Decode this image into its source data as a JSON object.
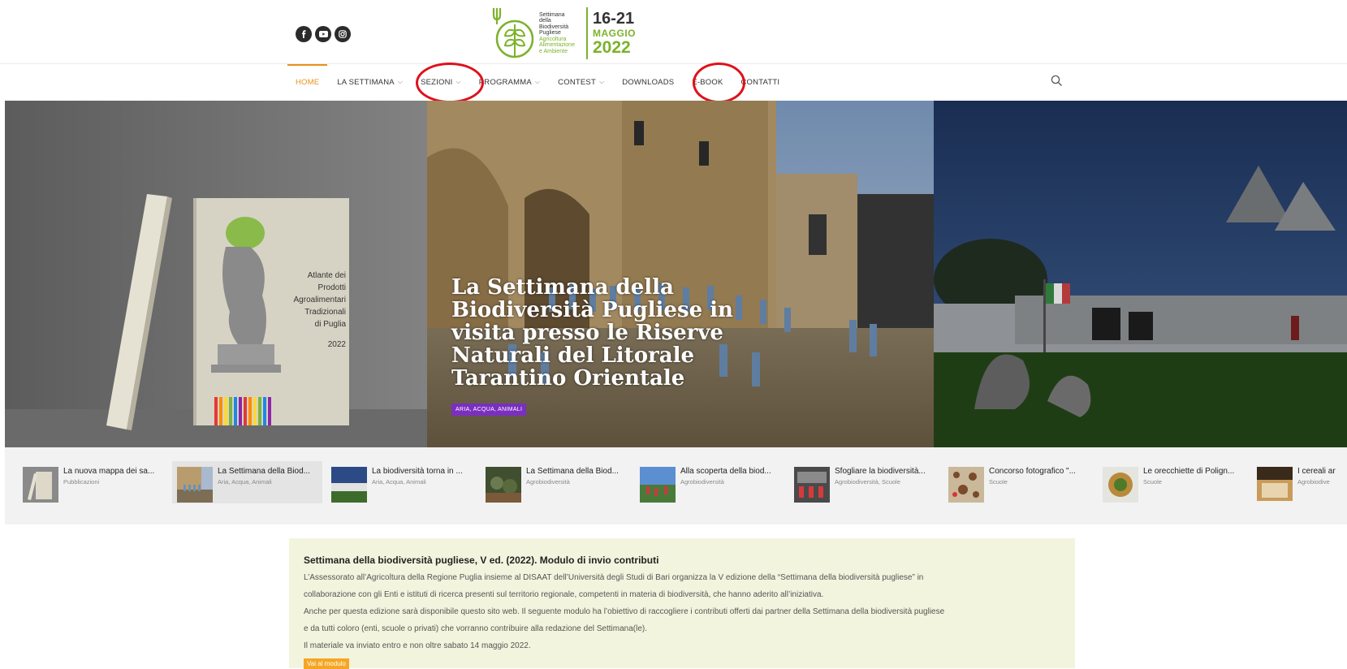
{
  "social": {
    "icons": [
      "facebook-icon",
      "youtube-icon",
      "instagram-icon"
    ]
  },
  "logo": {
    "lines": [
      "Settimana",
      "della",
      "Biodiversità",
      "Pugliese"
    ],
    "sub_lines": [
      "Agricoltura",
      "Alimentazione",
      "e Ambiente"
    ],
    "dates": "16-21",
    "month": "MAGGIO",
    "year": "2022"
  },
  "nav": {
    "items": [
      {
        "label": "HOME",
        "active": true,
        "dropdown": false
      },
      {
        "label": "LA SETTIMANA",
        "dropdown": true
      },
      {
        "label": "SEZIONI",
        "dropdown": true,
        "highlighted": true
      },
      {
        "label": "PROGRAMMA",
        "dropdown": true
      },
      {
        "label": "CONTEST",
        "dropdown": true
      },
      {
        "label": "DOWNLOADS",
        "dropdown": false
      },
      {
        "label": "E-BOOK",
        "dropdown": false,
        "highlighted": true
      },
      {
        "label": "CONTATTI",
        "dropdown": false
      }
    ],
    "accent": "#e8911a",
    "highlight_color": "#e0101a"
  },
  "book": {
    "title_lines": [
      "Atlante dei",
      "Prodotti",
      "Agroalimentari",
      "Tradizionali",
      "di Puglia"
    ],
    "year": "2022"
  },
  "slider": {
    "title": "La Settimana della Biodiversità Pugliese in visita presso le Riserve Naturali del Litorale Tarantino Orientale",
    "tag": "ARIA, ACQUA, ANIMALI",
    "tag_color": "#7a2fbf"
  },
  "thumbs": [
    {
      "title": "La nuova mappa dei sa...",
      "category": "Pubblicazioni"
    },
    {
      "title": "La Settimana della Biod...",
      "category": "Aria, Acqua, Animali",
      "selected": true
    },
    {
      "title": "La biodiversità torna in ...",
      "category": "Aria, Acqua, Animali"
    },
    {
      "title": "La Settimana della Biod...",
      "category": "Agrobiodiversità"
    },
    {
      "title": "Alla scoperta della biod...",
      "category": "Agrobiodiversità"
    },
    {
      "title": "Sfogliare la biodiversità...",
      "category": "Agrobiodiversità, Scuole"
    },
    {
      "title": "Concorso fotografico \"...",
      "category": "Scuole"
    },
    {
      "title": "Le orecchiette di Polign...",
      "category": "Scuole"
    },
    {
      "title": "I cereali ar",
      "category": "Agrobiodive"
    }
  ],
  "notice": {
    "title": "Settimana della biodiversità pugliese, V ed. (2022). Modulo di invio contributi",
    "lines": [
      "L’Assessorato all’Agricoltura della Regione Puglia insieme al DISAAT dell’Università degli Studi di Bari organizza la V edizione della “Settimana della biodiversità pugliese” in",
      "collaborazione con gli Enti e istituti di ricerca presenti sul territorio regionale, competenti in materia di biodiversità, che hanno aderito all’iniziativa.",
      "Anche per questa edizione sarà disponibile questo sito web. Il seguente modulo ha l’obiettivo di raccogliere i contributi offerti dai partner della Settimana della biodiversità pugliese",
      "e da tutti coloro (enti, scuole o privati) che vorranno contribuire alla redazione del Settimana(le).",
      "Il materiale va inviato entro e non oltre sabato 14 maggio 2022."
    ],
    "button": "Vai al modulo",
    "background": "#f3f4dd",
    "button_color": "#f5a623"
  }
}
